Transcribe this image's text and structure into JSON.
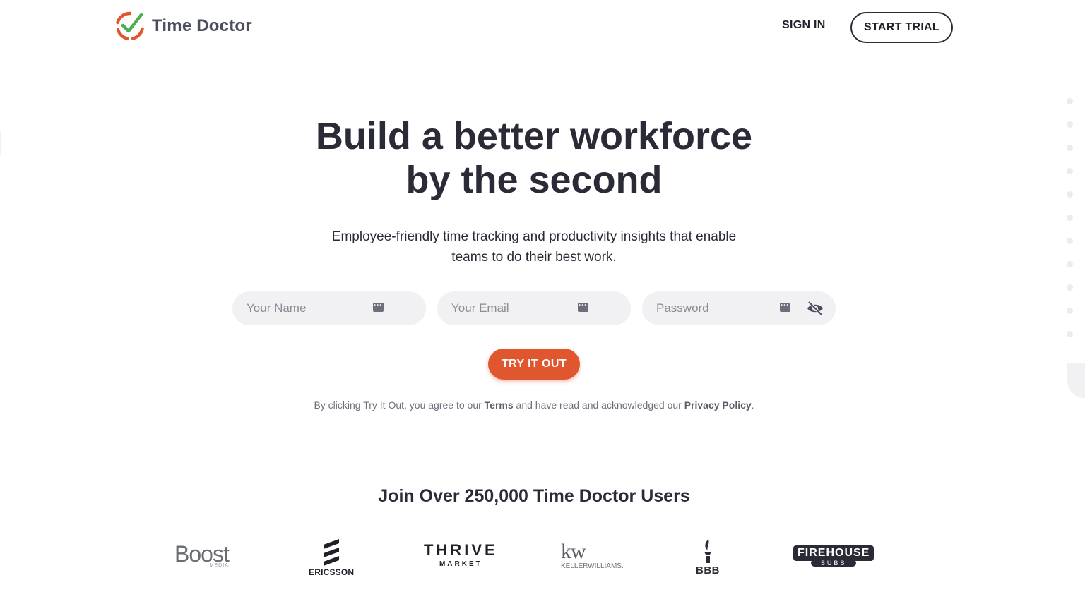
{
  "header": {
    "logo_text": "Time Doctor",
    "sign_in": "SIGN IN",
    "start_trial": "START TRIAL"
  },
  "hero": {
    "title_line1": "Build a better workforce",
    "title_line2": "by the second",
    "subtitle_line1": "Employee-friendly time tracking and productivity insights that enable",
    "subtitle_line2": "teams to do their best work."
  },
  "form": {
    "name_placeholder": "Your Name",
    "email_placeholder": "Your Email",
    "password_placeholder": "Password",
    "submit_label": "TRY IT OUT"
  },
  "legal": {
    "prefix": "By clicking Try It Out, you agree to our ",
    "terms": "Terms",
    "middle": " and have read and acknowledged our ",
    "privacy": "Privacy Policy",
    "suffix": "."
  },
  "social_proof": {
    "heading": "Join Over 250,000 Time Doctor Users",
    "logos": {
      "boost": "Boost",
      "boost_sub": "MEDIA",
      "ericsson": "ERICSSON",
      "thrive": "THRIVE",
      "thrive_sub": "– MARKET –",
      "kw": "kw",
      "kw_sub": "KELLERWILLIAMS.",
      "bbb": "BBB",
      "firehouse": "FIREHOUSE",
      "firehouse_sub": "SUBS"
    }
  },
  "colors": {
    "accent": "#e0572f",
    "text_dark": "#2a2b36",
    "field_bg": "#f1f1f3",
    "logo_green": "#4caf50"
  }
}
